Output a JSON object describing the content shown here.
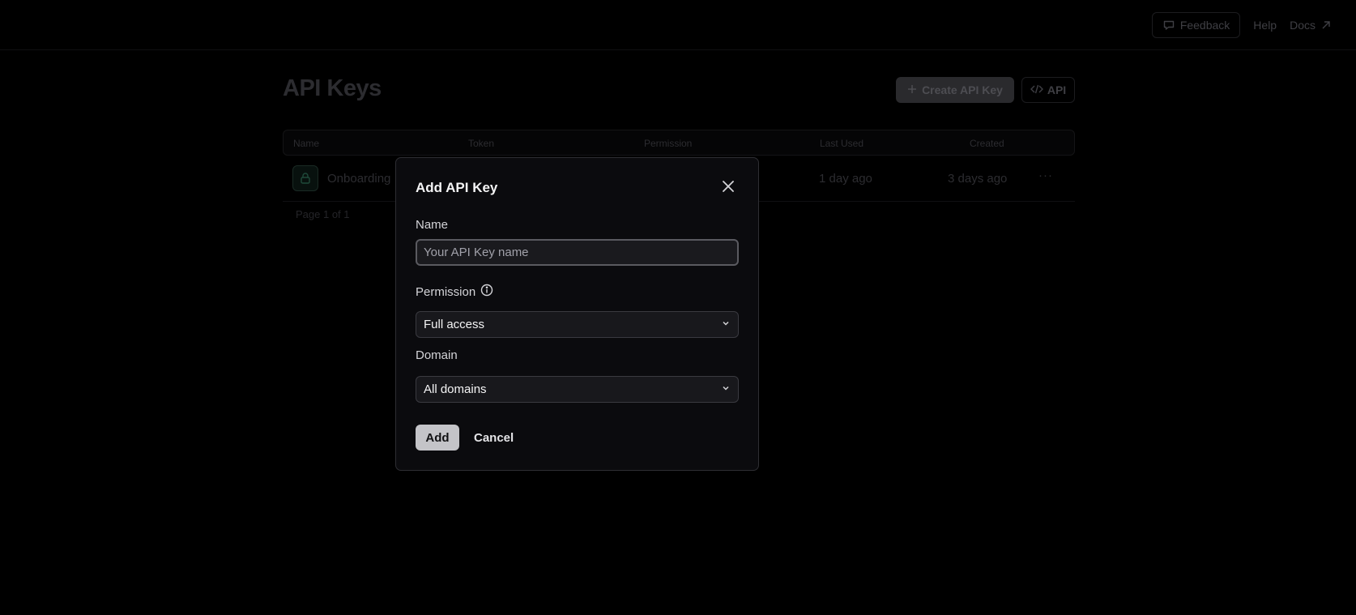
{
  "topbar": {
    "feedback_label": "Feedback",
    "help_label": "Help",
    "docs_label": "Docs"
  },
  "page": {
    "title": "API Keys",
    "create_label": "Create API Key",
    "api_label": "API"
  },
  "table": {
    "columns": [
      "Name",
      "Token",
      "Permission",
      "Last Used",
      "Created"
    ],
    "rows": [
      {
        "name": "Onboarding",
        "last_used": "1 day ago",
        "created": "3 days ago",
        "menu": "···"
      }
    ],
    "pager": "Page 1 of 1"
  },
  "modal": {
    "title": "Add API Key",
    "name_label": "Name",
    "name_placeholder": "Your API Key name",
    "name_value": "",
    "permission_label": "Permission",
    "permission_value": "Full access",
    "domain_label": "Domain",
    "domain_value": "All domains",
    "add_label": "Add",
    "cancel_label": "Cancel"
  },
  "colors": {
    "modal_bg": "#0b0b0e",
    "primary_button": "#c4c4c8",
    "page_bg": "#000000"
  }
}
